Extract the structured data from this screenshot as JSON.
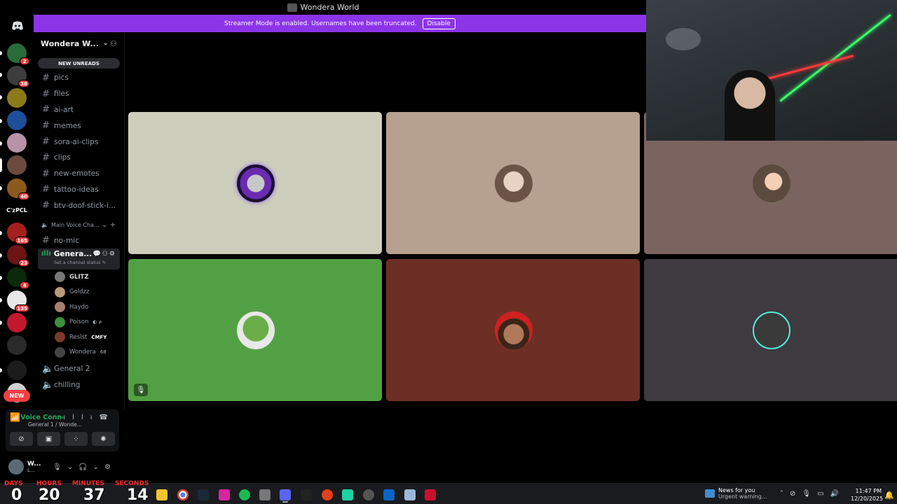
{
  "window_title": "Wondera World",
  "banner": {
    "message": "Streamer Mode is enabled. Usernames have been truncated.",
    "button": "Disable"
  },
  "rail": {
    "new_label": "NEW",
    "cozy_label": "C'zPCL",
    "badges": [
      "2",
      "38",
      "40",
      "165",
      "23",
      "4",
      "135"
    ]
  },
  "guild": {
    "name": "Wondera W..."
  },
  "new_unreads": "NEW UNREADS",
  "channels": [
    "pics",
    "files",
    "ai-art",
    "memes",
    "sora-ai-clips",
    "clips",
    "new-emotes",
    "tattoo-ideas",
    "btv-doof-stick-i..."
  ],
  "category": "Main Voice Cha...",
  "nomic": "no-mic",
  "voice_channel": {
    "name": "Genera...",
    "status": "Set a channel status"
  },
  "voice_users": [
    {
      "name": "GLITZ",
      "extra": ""
    },
    {
      "name": "Goldzz",
      "extra": ""
    },
    {
      "name": "Haydo",
      "extra": ""
    },
    {
      "name": "Poison",
      "extra": ""
    },
    {
      "name": "Reslst",
      "extra": "CMFY"
    },
    {
      "name": "Wondera",
      "extra": "68"
    }
  ],
  "other_voice": [
    "General 2",
    "chilling"
  ],
  "voice_panel": {
    "title": "Voice Connected",
    "sub": "General 1 / Wonde..."
  },
  "user": {
    "name": "W...",
    "sub": "L..."
  },
  "tiles": [
    {
      "bg": "#cccdbb"
    },
    {
      "bg": "#b6a08f"
    },
    {
      "bg": "#7b6460"
    },
    {
      "bg": "#52a044"
    },
    {
      "bg": "#6d2f25"
    },
    {
      "bg": "#3e3a3f"
    }
  ],
  "timer": {
    "days_label": "DAYS",
    "hours_label": "HOURS",
    "minutes_label": "MINUTES",
    "seconds_label": "SECONDS",
    "days": "0",
    "hours": "20",
    "minutes": "37",
    "seconds": "14"
  },
  "news": {
    "title": "News for you",
    "sub": "Urgent warning..."
  },
  "clock": {
    "time": "11:47 PM",
    "date": "12/20/2025"
  }
}
